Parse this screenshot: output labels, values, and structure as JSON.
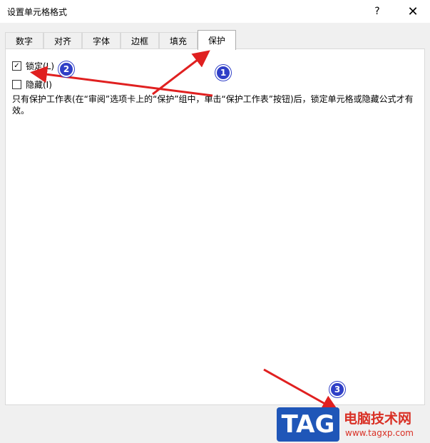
{
  "window": {
    "title": "设置单元格格式",
    "help_label": "?",
    "close_label": "✕"
  },
  "tabs": [
    {
      "label": "数字"
    },
    {
      "label": "对齐"
    },
    {
      "label": "字体"
    },
    {
      "label": "边框"
    },
    {
      "label": "填充"
    },
    {
      "label": "保护",
      "active": true
    }
  ],
  "protection": {
    "locked": {
      "label": "锁定(L)",
      "checked": true,
      "check_glyph": "✓"
    },
    "hidden": {
      "label": "隐藏(I)",
      "checked": false
    },
    "description": "只有保护工作表(在“审阅”选项卡上的“保护”组中，单击“保护工作表”按钮)后，锁定单元格或隐藏公式才有效。"
  },
  "annotations": {
    "badges": [
      "1",
      "2",
      "3"
    ],
    "color": "#e02020",
    "badge_color": "#2f3fc7"
  },
  "watermark": {
    "logo": "TAG",
    "site_name": "电脑技术网",
    "url": "www.tagxp.com"
  },
  "colors": {
    "accent": "#1f56b8",
    "watermark_red": "#d93025"
  }
}
